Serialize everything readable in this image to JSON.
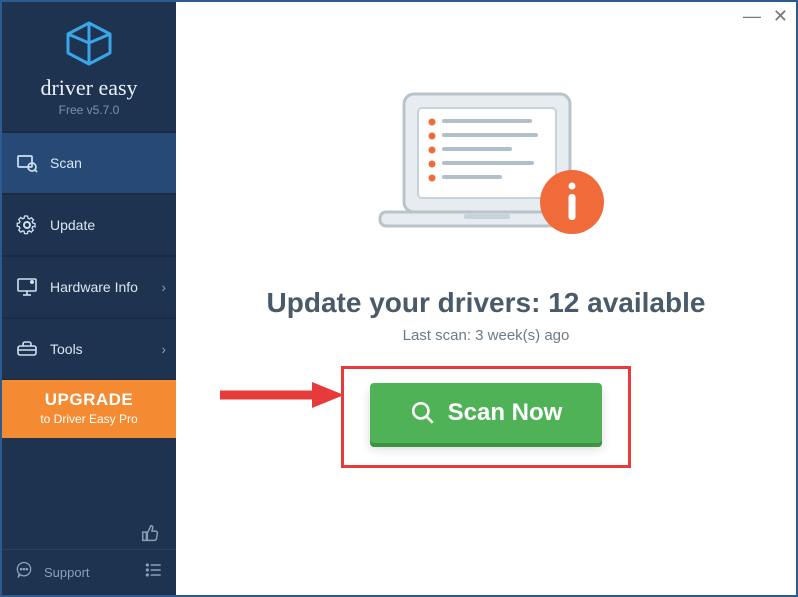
{
  "app": {
    "brand": "driver easy",
    "version": "Free v5.7.0"
  },
  "sidebar": {
    "items": [
      {
        "label": "Scan",
        "icon": "scan-icon",
        "has_submenu": false,
        "active": true
      },
      {
        "label": "Update",
        "icon": "gear-icon",
        "has_submenu": false,
        "active": false
      },
      {
        "label": "Hardware Info",
        "icon": "monitor-icon",
        "has_submenu": true,
        "active": false
      },
      {
        "label": "Tools",
        "icon": "tools-icon",
        "has_submenu": true,
        "active": false
      }
    ],
    "upgrade": {
      "line1": "UPGRADE",
      "line2": "to Driver Easy Pro"
    },
    "support_label": "Support"
  },
  "main": {
    "headline_prefix": "Update your drivers: ",
    "available_count": 12,
    "headline_suffix": " available",
    "last_scan_label": "Last scan: 3 week(s) ago",
    "scan_button_label": "Scan Now"
  },
  "colors": {
    "sidebar_bg": "#1e3350",
    "sidebar_active": "#264a75",
    "upgrade_bg": "#f48b32",
    "scan_btn_bg": "#4fb257",
    "info_badge": "#f06a3a",
    "annotation_red": "#e73a3a"
  }
}
